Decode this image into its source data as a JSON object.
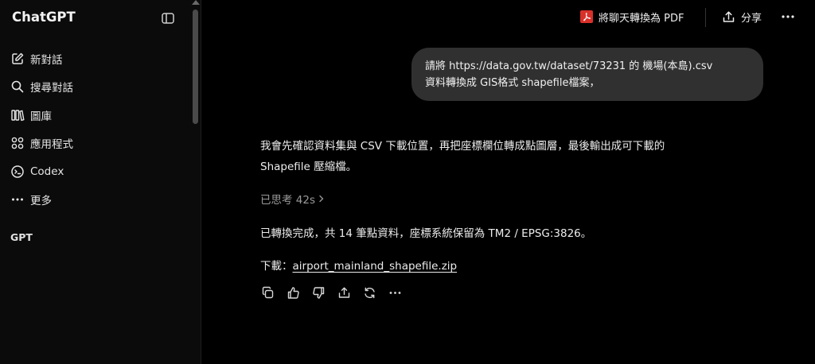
{
  "sidebar": {
    "brand": "ChatGPT",
    "items": [
      {
        "label": "新對話",
        "icon": "compose-icon"
      },
      {
        "label": "搜尋對話",
        "icon": "search-icon"
      },
      {
        "label": "圖庫",
        "icon": "library-icon"
      },
      {
        "label": "應用程式",
        "icon": "apps-grid-icon"
      },
      {
        "label": "Codex",
        "icon": "codex-icon"
      },
      {
        "label": "更多",
        "icon": "more-horizontal-icon"
      }
    ],
    "section_title": "GPT"
  },
  "topbar": {
    "pdf_label": "將聊天轉換為 PDF",
    "share_label": "分享"
  },
  "user_message": {
    "line1": "請將 https://data.gov.tw/dataset/73231 的 機場(本島).csv",
    "line2": "資料轉換成 GIS格式 shapefile檔案，"
  },
  "assistant": {
    "intro_line1": "我會先確認資料集與 CSV 下載位置，再把座標欄位轉成點圖層，最後輸出成可下載的",
    "intro_line2": "Shapefile 壓縮檔。",
    "thought": "已思考 42s",
    "result": "已轉換完成，共 14 筆點資料，座標系統保留為 TM2 / EPSG:3826。",
    "download_prefix": "下載：",
    "download_link": "airport_mainland_shapefile.zip"
  },
  "colors": {
    "background": "#000000",
    "sidebar": "#0b0b0b",
    "bubble": "#303030",
    "pdf_red": "#d9302a"
  }
}
